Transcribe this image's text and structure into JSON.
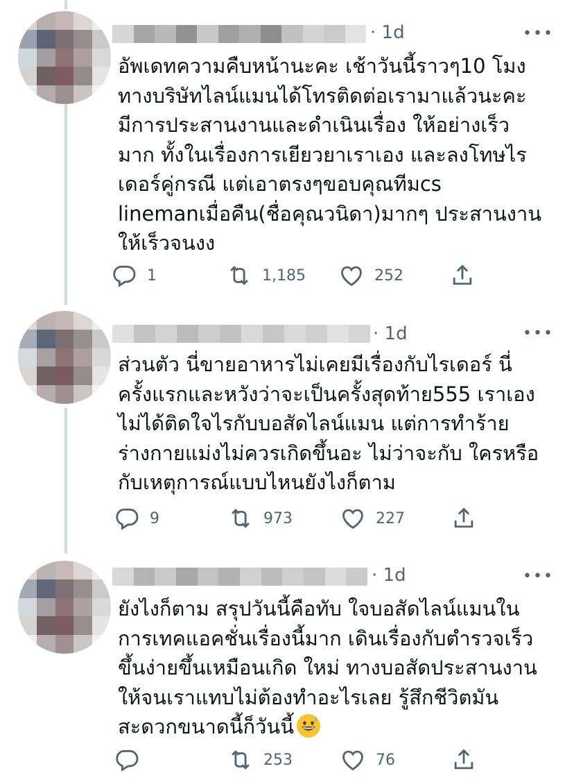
{
  "tweets": [
    {
      "time": "· 1d",
      "text": "อัพเดทความคืบหน้านะคะ เช้าวันนี้ราวๆ10 โมง\nทางบริษัทไลน์แมนได้โทรติดต่อเรามาแล้วนะคะ\nมีการประสานงานและดำเนินเรื่อง ให้อย่างเร็ว\nมาก ทั้งในเรื่องการเยียวยาเราเอง และลงโทษไร\nเดอร์คู่กรณี แต่เอาตรงๆขอบคุณทีมcs\nlinemanเมื่อคืน(ชื่อคุณวนิดา)มากๆ ประสานงาน\nให้เร็วจนงง",
      "replies": "1",
      "retweets": "1,185",
      "likes": "252"
    },
    {
      "time": "· 1d",
      "text": "ส่วนตัว นี่ขายอาหารไม่เคยมีเรื่องกับไรเดอร์ นี่\nครั้งแรกและหวังว่าจะเป็นครั้งสุดท้าย555 เราเอง\nไม่ได้ติดใจไรกับบอสัดไลน์แมน แต่การทำร้าย\nร่างกายแม่งไม่ควรเกิดขึ้นอะ ไม่ว่าจะกับ ใครหรือ\nกับเหตุการณ์แบบไหนยังไงก็ตาม",
      "replies": "9",
      "retweets": "973",
      "likes": "227"
    },
    {
      "time": "· 1d",
      "text": "ยังไงก็ตาม สรุปวันนี้คือทับ ใจบอสัดไลน์แมนใน\nการเทคแอคชั่นเรื่องนี้มาก เดินเรื่องกับตำรวจเร็ว\nขึ้นง่ายขึ้นเหมือนเกิด ใหม่ ทางบอสัดประสานงาน\nให้จนเราแทบไม่ต้องทำอะไรเลย รู้สึกชีวิตมัน\nสะดวกขนาดนี้ก็วันนี้",
      "replies": "",
      "retweets": "253",
      "likes": "76"
    }
  ],
  "more_label": "•••",
  "icons": {
    "reply": "reply-icon",
    "retweet": "retweet-icon",
    "like": "heart-icon",
    "share": "share-icon",
    "emoji": "grinning-sweat-emoji"
  }
}
